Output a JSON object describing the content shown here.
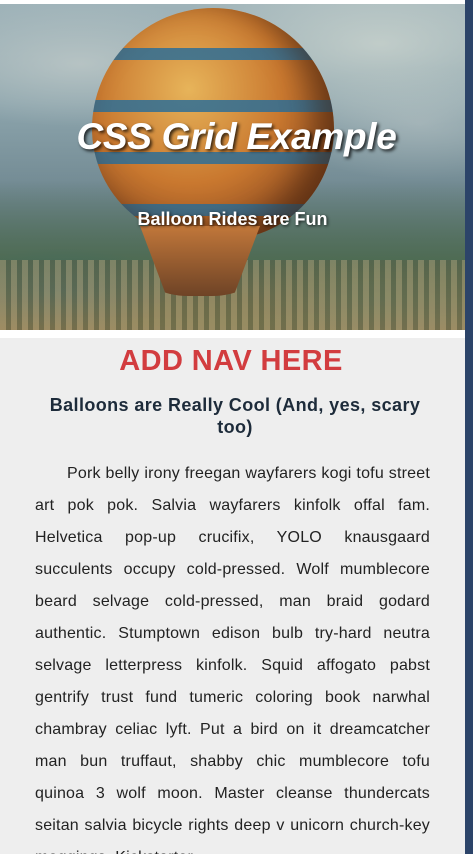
{
  "header": {
    "title": "CSS Grid Example",
    "subtitle": "Balloon Rides are Fun"
  },
  "nav": {
    "placeholder": "ADD NAV HERE"
  },
  "main": {
    "heading": "Balloons are Really Cool (And, yes, scary too)",
    "paragraph": "Pork belly irony freegan wayfarers kogi tofu street art pok pok. Salvia wayfarers kinfolk offal fam. Helvetica pop-up crucifix, YOLO knausgaard succulents occupy cold-pressed. Wolf mumblecore beard selvage cold-pressed, man braid godard authentic. Stumptown edison bulb try-hard neutra selvage letterpress kinfolk. Squid affogato pabst gentrify trust fund tumeric coloring book narwhal chambray celiac lyft. Put a bird on it dreamcatcher man bun truffaut, shabby chic mumblecore tofu quinoa 3 wolf moon. Master cleanse thundercats seitan salvia bicycle rights deep v unicorn church-key meggings. Kickstarter"
  },
  "colors": {
    "nav_placeholder": "#d23c3f",
    "heading": "#1d2b3a",
    "content_background": "#eeeeee",
    "edge_strip": "#2c4469"
  },
  "icons": {
    "hero_image": "hot-air-balloon-illustration"
  }
}
